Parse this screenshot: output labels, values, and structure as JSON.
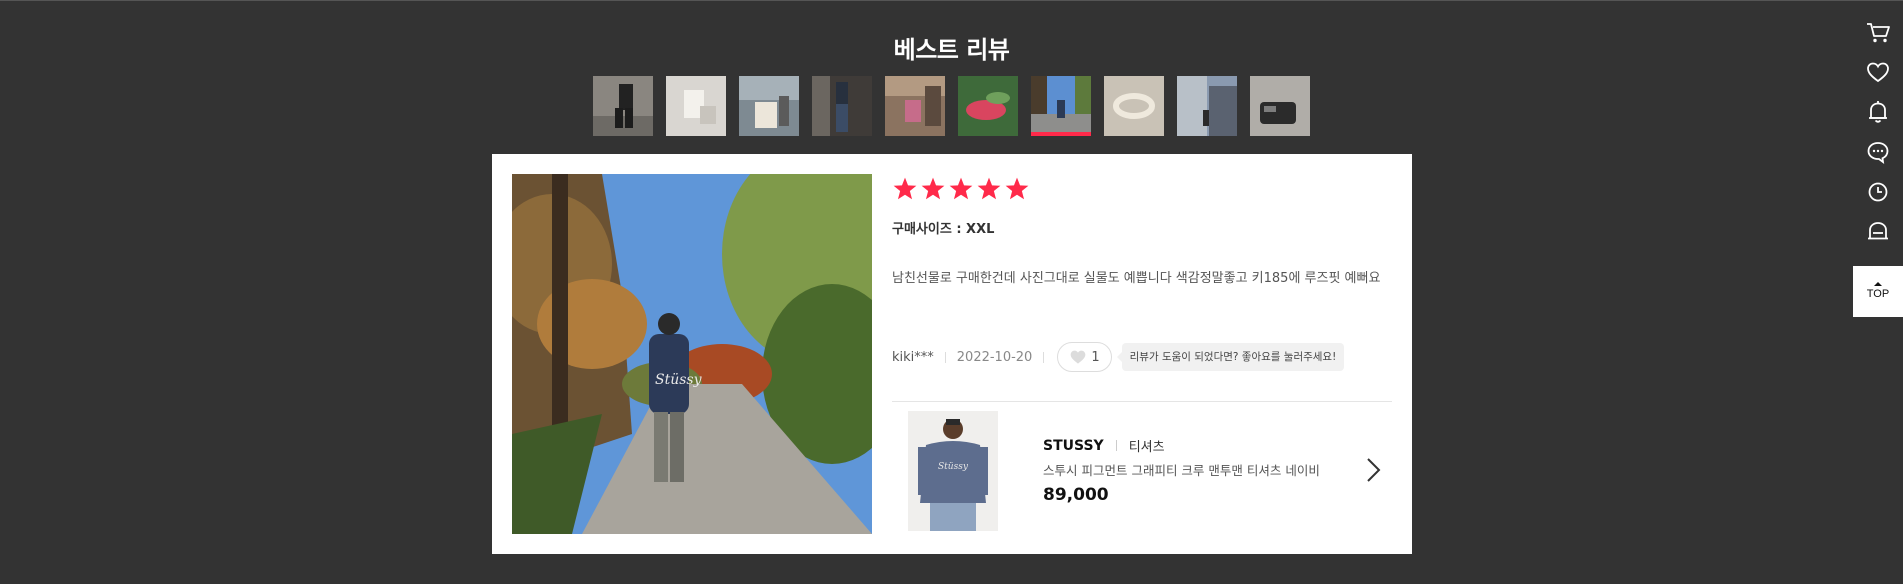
{
  "section_title": "베스트 리뷰",
  "thumbnails": [
    {
      "icon": "review-thumb-photo",
      "active": false
    },
    {
      "icon": "review-thumb-photo",
      "active": false
    },
    {
      "icon": "review-thumb-photo",
      "active": false
    },
    {
      "icon": "review-thumb-photo",
      "active": false
    },
    {
      "icon": "review-thumb-photo",
      "active": false
    },
    {
      "icon": "review-thumb-photo",
      "active": false
    },
    {
      "icon": "review-thumb-photo",
      "active": true
    },
    {
      "icon": "review-thumb-photo",
      "active": false
    },
    {
      "icon": "review-thumb-photo",
      "active": false
    },
    {
      "icon": "review-thumb-photo",
      "active": false
    }
  ],
  "review": {
    "rating": 5,
    "max_rating": 5,
    "star_color": "#ff2a4a",
    "purchase_size": "구매사이즈 : XXL",
    "text": "남친선물로 구매한건데 사진그대로 실물도 예쁩니다 색감정말좋고 키185에 루즈핏 예뻐요",
    "author": "kiki***",
    "date": "2022-10-20",
    "like_count": "1",
    "like_tip": "리뷰가 도움이 되었다면? 좋아요를 눌러주세요!"
  },
  "product": {
    "brand": "STUSSY",
    "category": "티셔츠",
    "name": "스투시 피그먼트 그래피티 크루 맨투맨 티셔츠 네이비",
    "price": "89,000"
  },
  "side_rail": {
    "icons": [
      "cart-icon",
      "heart-icon",
      "bell-icon",
      "chat-icon",
      "clock-icon",
      "bot-icon"
    ],
    "top_label": "TOP"
  },
  "colors": {
    "background": "#333333",
    "accent": "#ff2a4a",
    "card": "#ffffff"
  }
}
